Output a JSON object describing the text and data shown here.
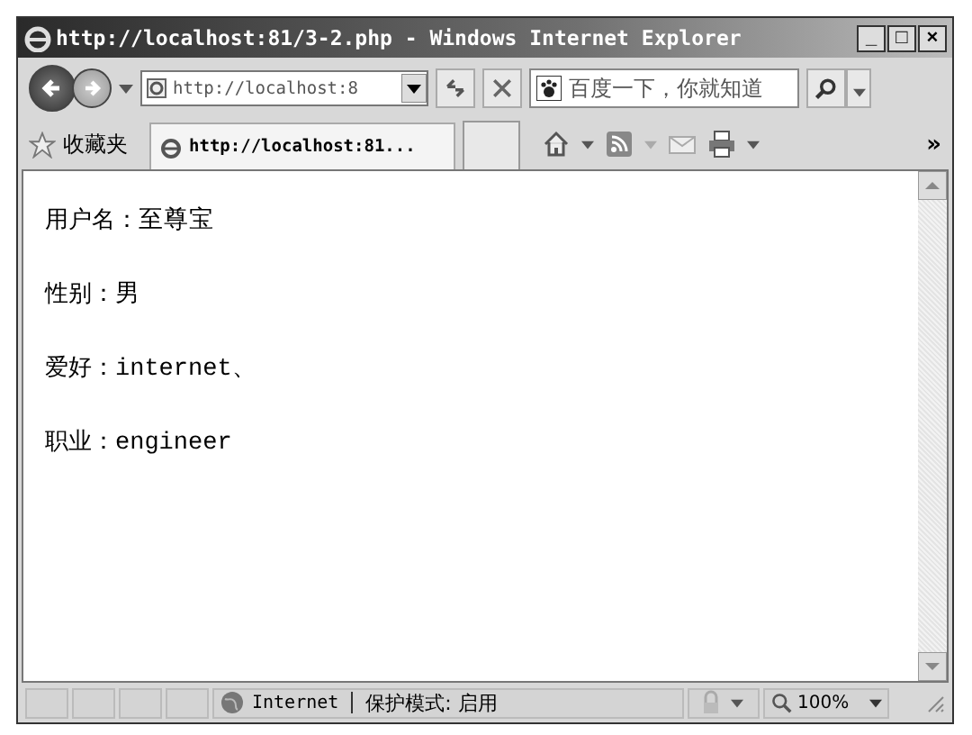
{
  "window": {
    "title": "http://localhost:81/3-2.php - Windows Internet Explorer",
    "controls": [
      "_",
      "□",
      "×"
    ]
  },
  "address_bar": {
    "value": "http://localhost:8"
  },
  "search": {
    "placeholder": "百度一下，你就知道"
  },
  "favorites": {
    "label": "收藏夹",
    "tab": "http://localhost:81...",
    "chevron": "»"
  },
  "content": [
    {
      "label": "用户名：",
      "value": "至尊宝"
    },
    {
      "label": "性别：",
      "value": "男"
    },
    {
      "label": "爱好：",
      "value": "internet、"
    },
    {
      "label": "职业：",
      "value": "engineer"
    }
  ],
  "status_bar": {
    "zone": "Internet",
    "mode": "保护模式: 启用",
    "zoom": "100%"
  }
}
